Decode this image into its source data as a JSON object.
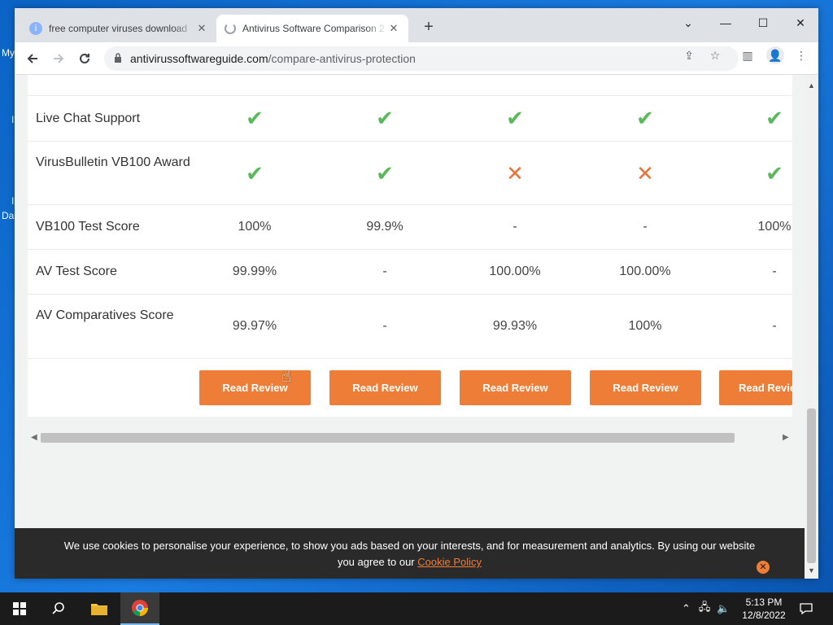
{
  "desktop": {
    "fragments": [
      "My",
      "I",
      "I",
      "Da"
    ]
  },
  "browser": {
    "tabs": [
      {
        "title": "free computer viruses download",
        "close": "✕",
        "active": false
      },
      {
        "title": "Antivirus Software Comparison 2",
        "close": "✕",
        "active": true
      }
    ],
    "new_tab": "+",
    "window_controls": [
      "⌄",
      "—",
      "☐",
      "✕"
    ],
    "url_host": "antivirussoftwareguide.com",
    "url_path": "/compare-antivirus-protection"
  },
  "table": {
    "rows": [
      {
        "label": "Live Chat Support",
        "cells": [
          "check",
          "check",
          "check",
          "check",
          "check"
        ]
      },
      {
        "label": "VirusBulletin VB100 Award",
        "cells": [
          "check",
          "check",
          "cross",
          "cross",
          "check"
        ]
      },
      {
        "label": "VB100 Test Score",
        "cells": [
          "100%",
          "99.9%",
          "-",
          "-",
          "100%"
        ]
      },
      {
        "label": "AV Test Score",
        "cells": [
          "99.99%",
          "-",
          "100.00%",
          "100.00%",
          "-"
        ]
      },
      {
        "label": "AV Comparatives Score",
        "cells": [
          "99.97%",
          "-",
          "99.93%",
          "100%",
          "-"
        ]
      }
    ],
    "button_label": "Read Review"
  },
  "cookie": {
    "text": "We use cookies to personalise your experience, to show you ads based on your interests, and for measurement and analytics. By using our website",
    "text2": "you agree to our",
    "link": "Cookie Policy",
    "close": "✕"
  },
  "taskbar": {
    "time": "5:13 PM",
    "date": "12/8/2022"
  },
  "colors": {
    "accent": "#ee7e37",
    "check": "#5cb85c",
    "cross": "#e8743b"
  }
}
